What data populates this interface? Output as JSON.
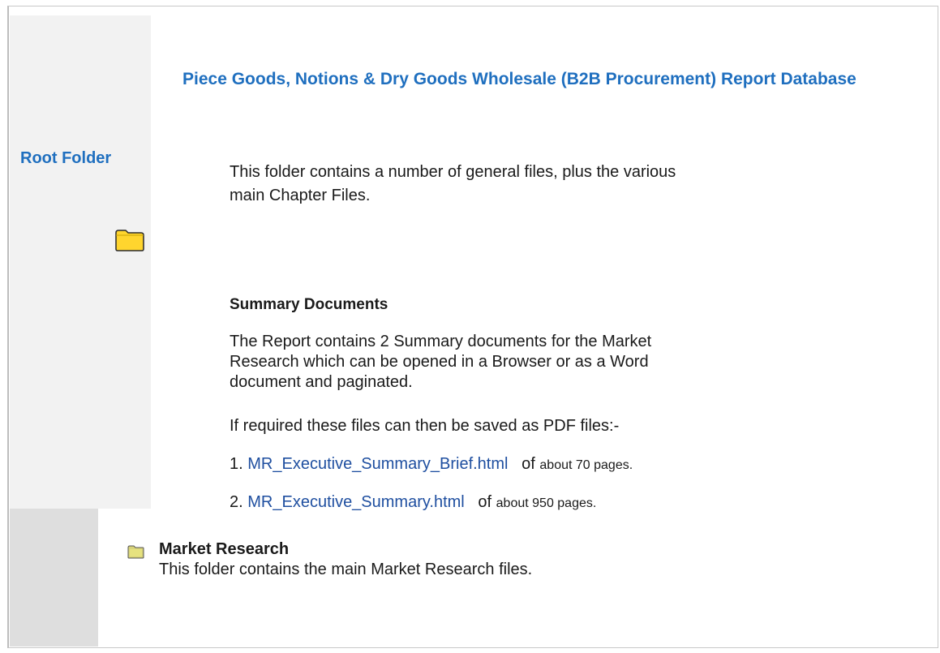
{
  "title": "Piece Goods, Notions & Dry Goods Wholesale (B2B Procurement) Report Database",
  "root_folder": {
    "label": "Root Folder",
    "icon": "folder-icon"
  },
  "intro": "This folder contains a number of general files, plus the various main Chapter Files.",
  "summary": {
    "heading": "Summary Documents",
    "description": "The Report contains 2 Summary documents for the Market Research which can be opened in a Browser or as a Word document and paginated.",
    "pdf_note": "If required these files can then be saved as PDF files:-",
    "documents": [
      {
        "number": "1.",
        "link": "MR_Executive_Summary_Brief.html",
        "of": "of",
        "pages": "about 70 pages."
      },
      {
        "number": "2.",
        "link": "MR_Executive_Summary.html",
        "of": "of",
        "pages": "about 950 pages."
      }
    ]
  },
  "market_research": {
    "heading": "Market Research",
    "description": "This folder contains the main Market Research files.",
    "icon": "folder-icon"
  },
  "colors": {
    "title": "#1f6fbf",
    "link": "#1f4fa0",
    "folder_fill": "#ffd52e",
    "left_panel": "#f2f2f2"
  }
}
